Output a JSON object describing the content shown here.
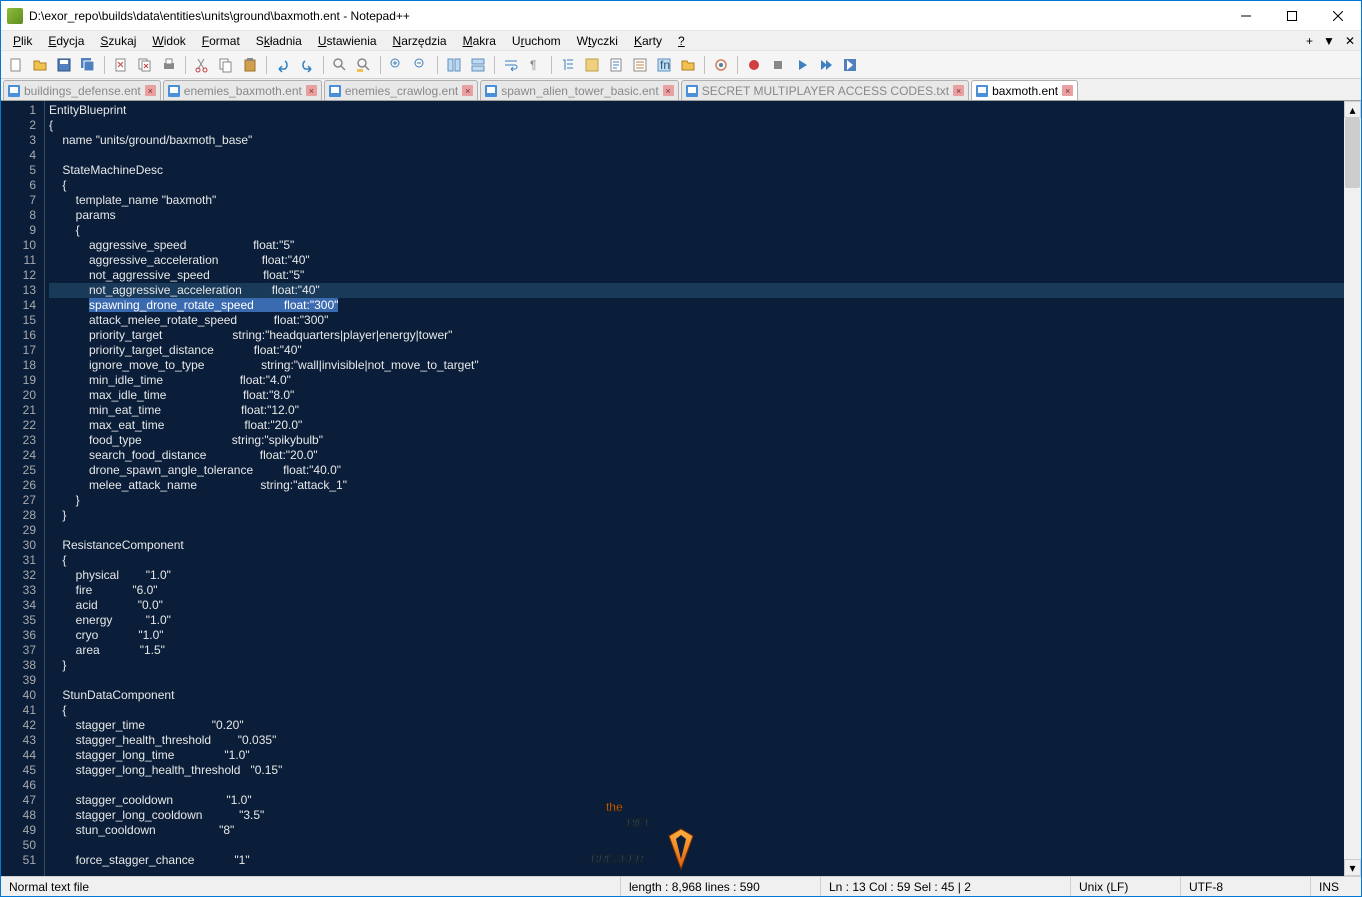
{
  "window": {
    "title": "D:\\exor_repo\\builds\\data\\entities\\units\\ground\\baxmoth.ent - Notepad++"
  },
  "menu": {
    "items": [
      "Plik",
      "Edycja",
      "Szukaj",
      "Widok",
      "Format",
      "Składnia",
      "Ustawienia",
      "Narzędzia",
      "Makra",
      "Uruchom",
      "Wtyczki",
      "Karty",
      "?"
    ]
  },
  "tabs": [
    {
      "label": "buildings_defense.ent",
      "active": false
    },
    {
      "label": "enemies_baxmoth.ent",
      "active": false
    },
    {
      "label": "enemies_crawlog.ent",
      "active": false
    },
    {
      "label": "spawn_alien_tower_basic.ent",
      "active": false
    },
    {
      "label": "SECRET MULTIPLAYER ACCESS CODES.txt",
      "active": false
    },
    {
      "label": "baxmoth.ent",
      "active": true
    }
  ],
  "code": {
    "lines": [
      "EntityBlueprint",
      "{",
      "    name \"units/ground/baxmoth_base\"",
      "",
      "    StateMachineDesc",
      "    {",
      "        template_name \"baxmoth\"",
      "        params",
      "        {",
      "            aggressive_speed                    float:\"5\"",
      "            aggressive_acceleration             float:\"40\"",
      "            not_aggressive_speed                float:\"5\"",
      "            not_aggressive_acceleration         float:\"40\"",
      "            spawning_drone_rotate_speed         float:\"300\"",
      "            attack_melee_rotate_speed           float:\"300\"",
      "            priority_target                     string:\"headquarters|player|energy|tower\"",
      "            priority_target_distance            float:\"40\"",
      "            ignore_move_to_type                 string:\"wall|invisible|not_move_to_target\"",
      "            min_idle_time                       float:\"4.0\"",
      "            max_idle_time                       float:\"8.0\"",
      "            min_eat_time                        float:\"12.0\"",
      "            max_eat_time                        float:\"20.0\"",
      "            food_type                           string:\"spikybulb\"",
      "            search_food_distance                float:\"20.0\"",
      "            drone_spawn_angle_tolerance         float:\"40.0\"",
      "            melee_attack_name                   string:\"attack_1\"",
      "        }",
      "    }",
      "",
      "    ResistanceComponent",
      "    {",
      "        physical        \"1.0\"",
      "        fire            \"6.0\"",
      "        acid            \"0.0\"",
      "        energy          \"1.0\"",
      "        cryo            \"1.0\"",
      "        area            \"1.5\"",
      "    }",
      "",
      "    StunDataComponent",
      "    {",
      "        stagger_time                    \"0.20\"",
      "        stagger_health_threshold        \"0.035\"",
      "        stagger_long_time               \"1.0\"",
      "        stagger_long_health_threshold   \"0.15\"",
      "",
      "        stagger_cooldown                \"1.0\"",
      "        stagger_long_cooldown           \"3.5\"",
      "        stun_cooldown                   \"8\"",
      "",
      "        force_stagger_chance            \"1\""
    ],
    "cursor_line": 13,
    "selected_line": 14
  },
  "statusbar": {
    "filetype": "Normal text file",
    "length": "length : 8,968    lines : 590",
    "pos": "Ln : 13   Col : 59   Sel : 45 | 2",
    "eol": "Unix (LF)",
    "encoding": "UTF-8",
    "mode": "INS"
  },
  "logo": {
    "text_top": "the",
    "text_main1": "RIFT",
    "text_main2": "BREAKER"
  }
}
